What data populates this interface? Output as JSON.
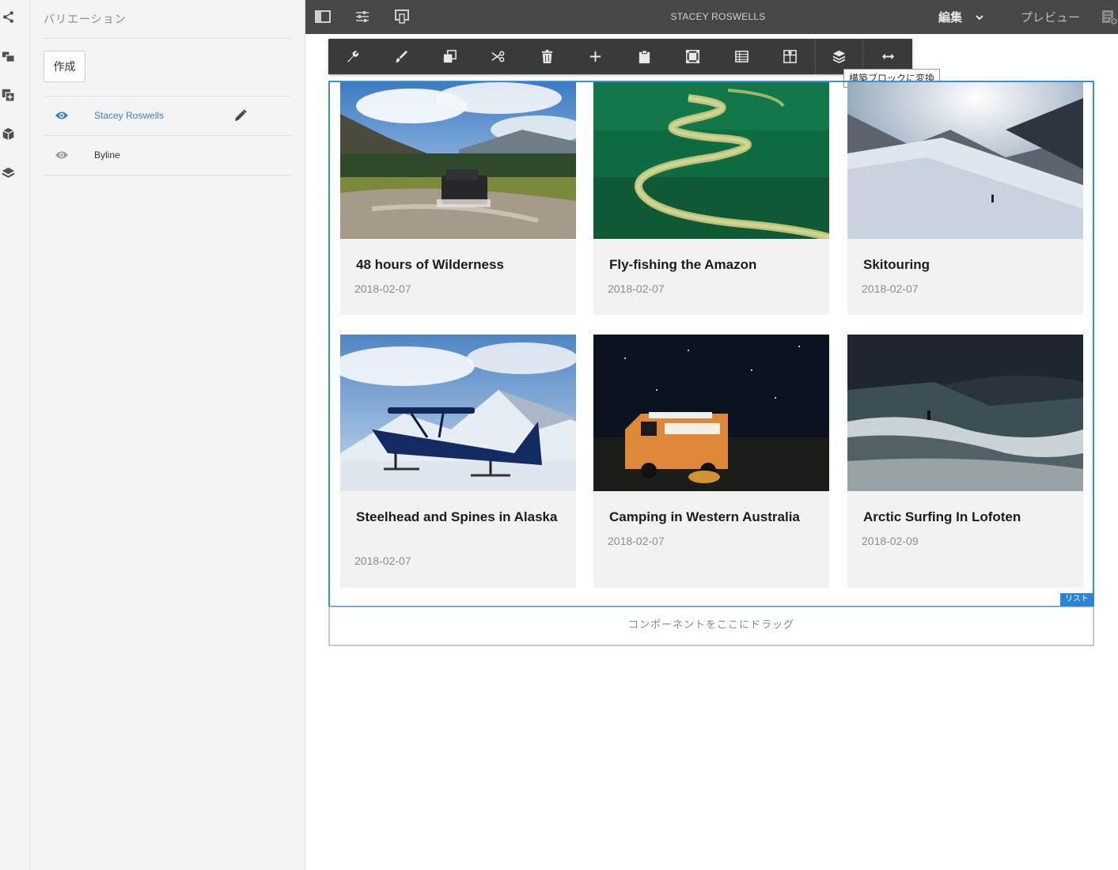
{
  "rail": {
    "icons": [
      "share-icon",
      "assets-icon",
      "add-component-icon",
      "cube-icon",
      "layers-icon"
    ]
  },
  "panel": {
    "title": "バリエーション",
    "create_label": "作成",
    "variations": [
      {
        "label": "Stacey Roswells",
        "active": true
      },
      {
        "label": "Byline",
        "active": false
      }
    ]
  },
  "topbar": {
    "title": "STACEY ROSWELLS",
    "edit_label": "編集",
    "preview_label": "プレビュー"
  },
  "toolbar": {
    "tooltip": "構築ブロックに変換",
    "buttons": [
      "configure",
      "style",
      "copy",
      "cut",
      "delete",
      "insert",
      "paste",
      "group",
      "template",
      "layout",
      "convert-to-building-block",
      "resize"
    ]
  },
  "list": {
    "badge": "リスト",
    "cards": [
      {
        "title": "48 hours of Wilderness",
        "date": "2018-02-07"
      },
      {
        "title": "Fly-fishing the Amazon",
        "date": "2018-02-07"
      },
      {
        "title": "Skitouring",
        "date": "2018-02-07"
      },
      {
        "title": "Steelhead and Spines in Alaska",
        "date": "2018-02-07"
      },
      {
        "title": "Camping in Western Australia",
        "date": "2018-02-07"
      },
      {
        "title": "Arctic Surfing In Lofoten",
        "date": "2018-02-09"
      }
    ]
  },
  "dropzone": {
    "label": "コンポーネントをここにドラッグ"
  },
  "colors": {
    "accent": "#3b8ede",
    "topbar": "#474747",
    "toolbar": "#3a3a3a",
    "active_variation": "#3b7fd4"
  }
}
